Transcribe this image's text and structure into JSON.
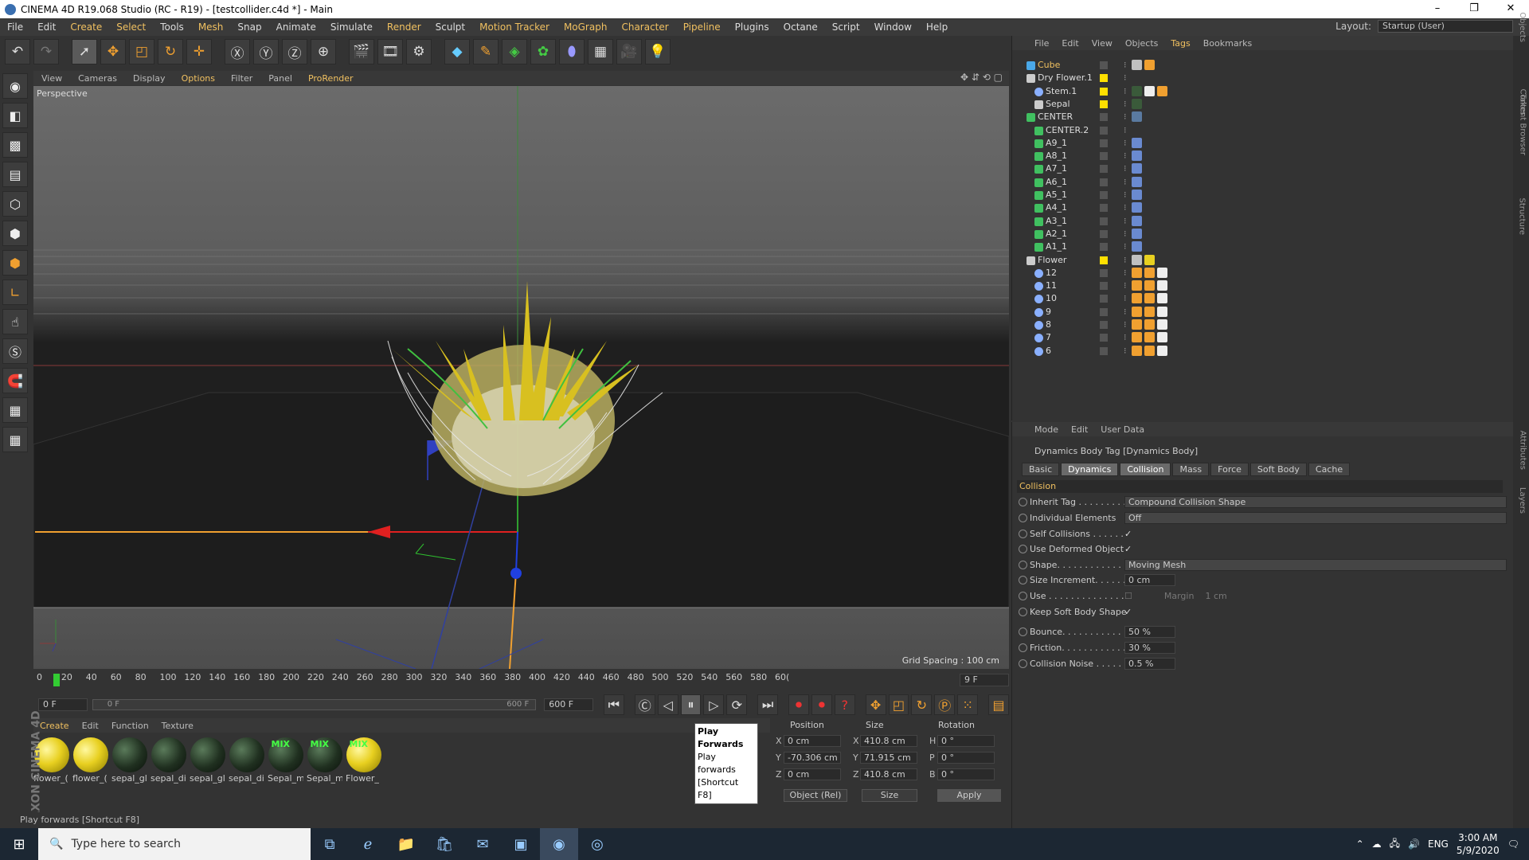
{
  "window": {
    "title": "CINEMA 4D R19.068 Studio (RC - R19) - [testcollider.c4d *] - Main",
    "minimize": "–",
    "maximize": "❐",
    "close": "✕"
  },
  "menu": [
    "File",
    "Edit",
    "Create",
    "Select",
    "Tools",
    "Mesh",
    "Snap",
    "Animate",
    "Simulate",
    "Render",
    "Sculpt",
    "Motion Tracker",
    "MoGraph",
    "Character",
    "Pipeline",
    "Plugins",
    "Octane",
    "Script",
    "Window",
    "Help"
  ],
  "menu_highlight": [
    "Create",
    "Select",
    "Mesh",
    "Render",
    "Motion Tracker",
    "MoGraph",
    "Character",
    "Pipeline"
  ],
  "layout": {
    "label": "Layout:",
    "value": "Startup (User)"
  },
  "viewport": {
    "menu": [
      "View",
      "Cameras",
      "Display",
      "Options",
      "Filter",
      "Panel",
      "ProRender"
    ],
    "active_menu": [
      "Options",
      "ProRender"
    ],
    "label": "Perspective",
    "grid_spacing": "Grid Spacing : 100 cm"
  },
  "timeline": {
    "ticks": [
      "0",
      "20",
      "40",
      "60",
      "80",
      "100",
      "120",
      "140",
      "160",
      "180",
      "200",
      "220",
      "240",
      "260",
      "280",
      "300",
      "320",
      "340",
      "360",
      "380",
      "400",
      "420",
      "440",
      "460",
      "480",
      "500",
      "520",
      "540",
      "560",
      "580",
      "60("
    ],
    "current_frame": "9 F",
    "start": "0 F",
    "range_left": "0 F",
    "range_right": "600 F",
    "end": "600 F"
  },
  "materials": {
    "menu": [
      "Create",
      "Edit",
      "Function",
      "Texture"
    ],
    "items": [
      {
        "name": "flower_(",
        "kind": "yellow",
        "mix": ""
      },
      {
        "name": "flower_(",
        "kind": "yellow",
        "mix": ""
      },
      {
        "name": "sepal_gl",
        "kind": "dark",
        "mix": ""
      },
      {
        "name": "sepal_di",
        "kind": "dark",
        "mix": ""
      },
      {
        "name": "sepal_gl",
        "kind": "dark",
        "mix": ""
      },
      {
        "name": "sepal_di",
        "kind": "dark",
        "mix": ""
      },
      {
        "name": "Sepal_m",
        "kind": "dark",
        "mix": "MIX"
      },
      {
        "name": "Sepal_m",
        "kind": "dark",
        "mix": "MIX"
      },
      {
        "name": "Flower_",
        "kind": "yellow",
        "mix": "MIX"
      }
    ]
  },
  "tooltip": {
    "title": "Play Forwards",
    "desc": "Play forwards",
    "shortcut": "[Shortcut F8]"
  },
  "coords": {
    "headers": [
      "Position",
      "Size",
      "Rotation"
    ],
    "rows": [
      {
        "a": "X",
        "pos": "0 cm",
        "b": "X",
        "size": "410.8 cm",
        "c": "H",
        "rot": "0 °"
      },
      {
        "a": "Y",
        "pos": "-70.306 cm",
        "b": "Y",
        "size": "71.915 cm",
        "c": "P",
        "rot": "0 °"
      },
      {
        "a": "Z",
        "pos": "0 cm",
        "b": "Z",
        "size": "410.8 cm",
        "c": "B",
        "rot": "0 °"
      }
    ],
    "mode": "Object (Rel)",
    "size_mode": "Size",
    "apply": "Apply"
  },
  "status": "Play forwards [Shortcut F8]",
  "branding": "MAXON CINEMA 4D",
  "objects": {
    "menu": [
      "File",
      "Edit",
      "View",
      "Objects",
      "Tags",
      "Bookmarks"
    ],
    "active_menu": [
      "Tags"
    ],
    "rows": [
      {
        "name": "Cube",
        "indent": 0,
        "icon": "cube",
        "sel": true,
        "tags": [
          "phong",
          "hair"
        ]
      },
      {
        "name": "Dry Flower.1",
        "indent": 0,
        "icon": "null",
        "sel": false,
        "tags": []
      },
      {
        "name": "Stem.1",
        "indent": 1,
        "icon": "joint",
        "sel": false,
        "tags": [
          "mat",
          "check",
          "hair"
        ]
      },
      {
        "name": "Sepal",
        "indent": 1,
        "icon": "null",
        "sel": false,
        "tags": [
          "mat"
        ]
      },
      {
        "name": "CENTER",
        "indent": 0,
        "icon": "spline",
        "sel": false,
        "tags": [
          "dyn"
        ]
      },
      {
        "name": "CENTER.2",
        "indent": 1,
        "icon": "spline",
        "sel": false,
        "tags": []
      },
      {
        "name": "A9_1",
        "indent": 1,
        "icon": "spline",
        "sel": false,
        "tags": [
          "ik"
        ]
      },
      {
        "name": "A8_1",
        "indent": 1,
        "icon": "spline",
        "sel": false,
        "tags": [
          "ik"
        ]
      },
      {
        "name": "A7_1",
        "indent": 1,
        "icon": "spline",
        "sel": false,
        "tags": [
          "ik"
        ]
      },
      {
        "name": "A6_1",
        "indent": 1,
        "icon": "spline",
        "sel": false,
        "tags": [
          "ik"
        ]
      },
      {
        "name": "A5_1",
        "indent": 1,
        "icon": "spline",
        "sel": false,
        "tags": [
          "ik"
        ]
      },
      {
        "name": "A4_1",
        "indent": 1,
        "icon": "spline",
        "sel": false,
        "tags": [
          "ik"
        ]
      },
      {
        "name": "A3_1",
        "indent": 1,
        "icon": "spline",
        "sel": false,
        "tags": [
          "ik"
        ]
      },
      {
        "name": "A2_1",
        "indent": 1,
        "icon": "spline",
        "sel": false,
        "tags": [
          "ik"
        ]
      },
      {
        "name": "A1_1",
        "indent": 1,
        "icon": "spline",
        "sel": false,
        "tags": [
          "ik"
        ]
      },
      {
        "name": "Flower",
        "indent": 0,
        "icon": "null",
        "sel": false,
        "tags": [
          "phong",
          "ball"
        ]
      },
      {
        "name": "12",
        "indent": 1,
        "icon": "joint",
        "sel": false,
        "tags": [
          "w",
          "hair",
          "check"
        ]
      },
      {
        "name": "11",
        "indent": 1,
        "icon": "joint",
        "sel": false,
        "tags": [
          "w",
          "hair",
          "check"
        ]
      },
      {
        "name": "10",
        "indent": 1,
        "icon": "joint",
        "sel": false,
        "tags": [
          "w",
          "hair",
          "check"
        ]
      },
      {
        "name": "9",
        "indent": 1,
        "icon": "joint",
        "sel": false,
        "tags": [
          "w",
          "hair",
          "check"
        ]
      },
      {
        "name": "8",
        "indent": 1,
        "icon": "joint",
        "sel": false,
        "tags": [
          "w",
          "hair",
          "check"
        ]
      },
      {
        "name": "7",
        "indent": 1,
        "icon": "joint",
        "sel": false,
        "tags": [
          "w",
          "hair",
          "check"
        ]
      },
      {
        "name": "6",
        "indent": 1,
        "icon": "joint",
        "sel": false,
        "tags": [
          "w",
          "hair",
          "check"
        ]
      }
    ]
  },
  "attributes": {
    "menu": [
      "Mode",
      "Edit",
      "User Data"
    ],
    "title": "Dynamics Body Tag [Dynamics Body]",
    "tabs": [
      "Basic",
      "Dynamics",
      "Collision",
      "Mass",
      "Force",
      "Soft Body",
      "Cache"
    ],
    "active_tabs": [
      "Dynamics",
      "Collision"
    ],
    "section": "Collision",
    "rows": [
      {
        "label": "Inherit Tag . . . . . . . . .",
        "type": "dropdown",
        "value": "Compound Collision Shape"
      },
      {
        "label": "Individual Elements",
        "type": "dropdown",
        "value": "Off"
      },
      {
        "label": "Self Collisions . . . . . .",
        "type": "check",
        "value": "✓"
      },
      {
        "label": "Use Deformed Object",
        "type": "check",
        "value": "✓"
      },
      {
        "label": "Shape. . . . . . . . . . . . . .",
        "type": "dropdown",
        "value": "Moving Mesh"
      },
      {
        "label": "Size Increment. . . . . .",
        "type": "num",
        "value": "0 cm"
      },
      {
        "label": "Use . . . . . . . . . . . . . .",
        "type": "use",
        "value": "Margin",
        "value2": "1 cm"
      },
      {
        "label": "Keep Soft Body Shape",
        "type": "check",
        "value": "✓"
      },
      {
        "label": "Bounce. . . . . . . . . . . . .",
        "type": "num",
        "value": "50 %"
      },
      {
        "label": "Friction. . . . . . . . . . . .",
        "type": "num",
        "value": "30 %"
      },
      {
        "label": "Collision Noise . . . . . .",
        "type": "num",
        "value": "0.5 %"
      }
    ]
  },
  "side_tabs": [
    "Objects",
    "Takes",
    "Content Browser",
    "Structure",
    "Attributes",
    "Layers"
  ],
  "taskbar": {
    "search_placeholder": "Type here to search",
    "lang": "ENG",
    "time": "3:00 AM",
    "date": "5/9/2020"
  }
}
